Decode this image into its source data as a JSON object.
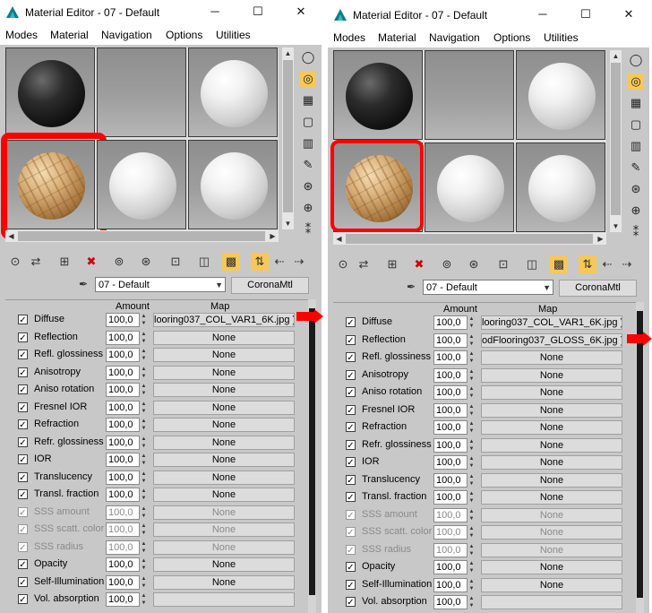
{
  "window": {
    "title": "Material Editor - 07 - Default",
    "menu": [
      "Modes",
      "Material",
      "Navigation",
      "Options",
      "Utilities"
    ],
    "buttons": {
      "minimize": "─",
      "maximize": "☐",
      "close": "✕"
    }
  },
  "slots": [
    {
      "type": "black"
    },
    {
      "type": "empty"
    },
    {
      "type": "white"
    },
    {
      "type": "wood",
      "selected": true
    },
    {
      "type": "white"
    },
    {
      "type": "white"
    }
  ],
  "material": {
    "name": "07 - Default",
    "type": "CoronaMtl"
  },
  "headers": {
    "amount": "Amount",
    "map": "Map"
  },
  "left_maps": [
    "looring037_COL_VAR1_6K.jpg )",
    "None",
    "None",
    "None",
    "None",
    "None",
    "None",
    "None",
    "None",
    "None",
    "None",
    "None",
    "None",
    "None",
    "None",
    "None"
  ],
  "right_maps": [
    "looring037_COL_VAR1_6K.jpg )",
    "odFlooring037_GLOSS_6K.jpg )",
    "None",
    "None",
    "None",
    "None",
    "None",
    "None",
    "None",
    "None",
    "None",
    "None",
    "None",
    "None",
    "None",
    "None"
  ],
  "rows": [
    {
      "label": "Diffuse",
      "amount": "100,0",
      "disabled": false
    },
    {
      "label": "Reflection",
      "amount": "100,0",
      "disabled": false
    },
    {
      "label": "Refl. glossiness",
      "amount": "100,0",
      "disabled": false
    },
    {
      "label": "Anisotropy",
      "amount": "100,0",
      "disabled": false
    },
    {
      "label": "Aniso rotation",
      "amount": "100,0",
      "disabled": false
    },
    {
      "label": "Fresnel IOR",
      "amount": "100,0",
      "disabled": false
    },
    {
      "label": "Refraction",
      "amount": "100,0",
      "disabled": false
    },
    {
      "label": "Refr. glossiness",
      "amount": "100,0",
      "disabled": false
    },
    {
      "label": "IOR",
      "amount": "100,0",
      "disabled": false
    },
    {
      "label": "Translucency",
      "amount": "100,0",
      "disabled": false
    },
    {
      "label": "Transl. fraction",
      "amount": "100,0",
      "disabled": false
    },
    {
      "label": "SSS amount",
      "amount": "100,0",
      "disabled": true
    },
    {
      "label": "SSS scatt. color",
      "amount": "100,0",
      "disabled": true
    },
    {
      "label": "SSS radius",
      "amount": "100,0",
      "disabled": true
    },
    {
      "label": "Opacity",
      "amount": "100,0",
      "disabled": false
    },
    {
      "label": "Self-Illumination",
      "amount": "100,0",
      "disabled": false
    },
    {
      "label": "Vol. absorption",
      "amount": "100,0",
      "disabled": false
    }
  ],
  "icons": {
    "side": [
      "sample-sphere-icon",
      "backlight-icon",
      "checker-background-icon",
      "sample-uv-icon",
      "video-color-check-icon",
      "make-preview-icon",
      "material-options-icon",
      "select-by-material-icon",
      "material-navigator-icon"
    ],
    "toolbar": [
      "get-material-icon",
      "put-to-scene-icon",
      "assign-to-selection-icon",
      "reset-map-icon",
      "make-copy-icon",
      "make-unique-icon",
      "put-to-library-icon",
      "material-id-icon",
      "show-shaded-icon",
      "show-end-result-icon",
      "go-to-parent-icon",
      "go-forward-icon"
    ]
  }
}
